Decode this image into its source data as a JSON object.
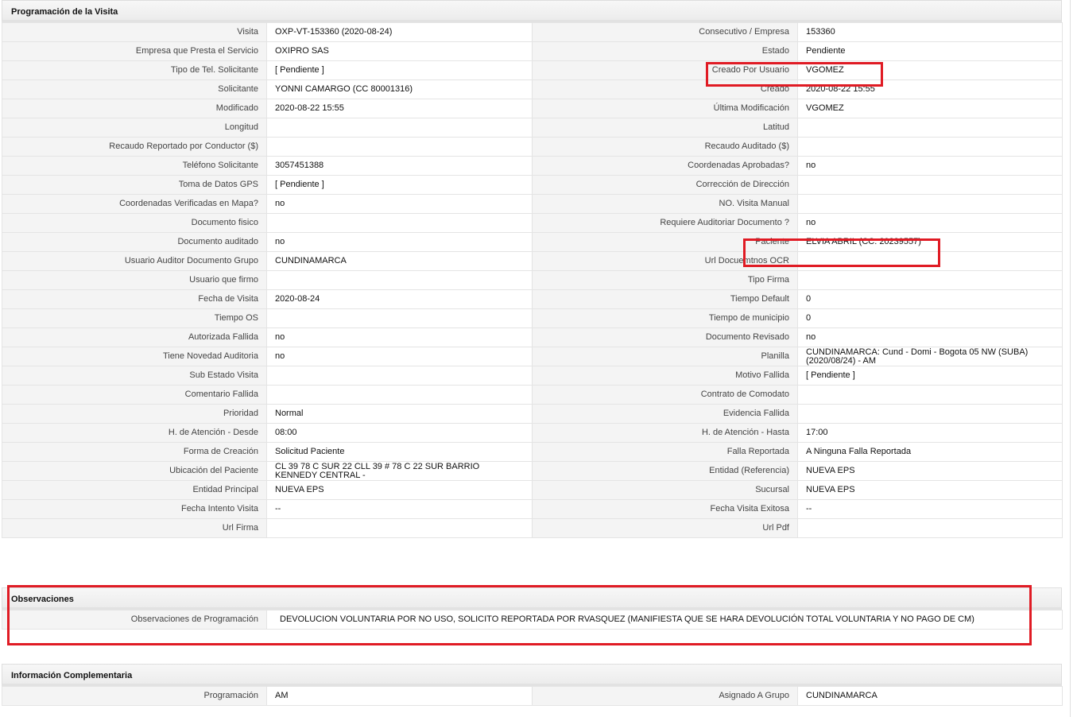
{
  "programacion": {
    "title": "Programación de la Visita",
    "rows": [
      [
        {
          "label": "Visita",
          "value": "OXP-VT-153360 (2020-08-24)"
        },
        {
          "label": "Consecutivo / Empresa",
          "value": "153360"
        }
      ],
      [
        {
          "label": "Empresa que Presta el Servicio",
          "value": "OXIPRO SAS"
        },
        {
          "label": "Estado",
          "value": "Pendiente"
        }
      ],
      [
        {
          "label": "Tipo de Tel. Solicitante",
          "value": "[ Pendiente ]"
        },
        {
          "label": "Creado Por Usuario",
          "value": "VGOMEZ"
        }
      ],
      [
        {
          "label": "Solicitante",
          "value": "YONNI CAMARGO (CC 80001316)"
        },
        {
          "label": "Creado",
          "value": "2020-08-22 15:55"
        }
      ],
      [
        {
          "label": "Modificado",
          "value": "2020-08-22 15:55"
        },
        {
          "label": "Última Modificación",
          "value": " VGOMEZ"
        }
      ],
      [
        {
          "label": "Longitud",
          "value": ""
        },
        {
          "label": "Latitud",
          "value": ""
        }
      ],
      [
        {
          "label": "Recaudo Reportado por Conductor ($)",
          "value": ""
        },
        {
          "label": "Recaudo Auditado ($)",
          "value": ""
        }
      ],
      [
        {
          "label": "Teléfono Solicitante",
          "value": "3057451388"
        },
        {
          "label": "Coordenadas Aprobadas?",
          "value": " no"
        }
      ],
      [
        {
          "label": "Toma de Datos GPS",
          "value": "[ Pendiente ]"
        },
        {
          "label": "Corrección de Dirección",
          "value": ""
        }
      ],
      [
        {
          "label": "Coordenadas Verificadas en Mapa?",
          "value": " no"
        },
        {
          "label": "NO. Visita Manual",
          "value": ""
        }
      ],
      [
        {
          "label": "Documento fisico",
          "value": ""
        },
        {
          "label": "Requiere Auditoriar Documento ?",
          "value": " no"
        }
      ],
      [
        {
          "label": "Documento auditado",
          "value": " no"
        },
        {
          "label": "Paciente",
          "value": "ELVIA ABRIL (CC: 20239557)"
        }
      ],
      [
        {
          "label": "Usuario Auditor Documento Grupo",
          "value": "CUNDINAMARCA"
        },
        {
          "label": "Url Docuemtnos OCR",
          "value": ""
        }
      ],
      [
        {
          "label": "Usuario que firmo",
          "value": ""
        },
        {
          "label": "Tipo Firma",
          "value": ""
        }
      ],
      [
        {
          "label": "Fecha de Visita",
          "value": " 2020-08-24"
        },
        {
          "label": "Tiempo Default",
          "value": "0"
        }
      ],
      [
        {
          "label": "Tiempo OS",
          "value": ""
        },
        {
          "label": "Tiempo de municipio",
          "value": "0"
        }
      ],
      [
        {
          "label": "Autorizada Fallida",
          "value": " no"
        },
        {
          "label": "Documento Revisado",
          "value": " no"
        }
      ],
      [
        {
          "label": "Tiene Novedad Auditoria",
          "value": " no"
        },
        {
          "label": "Planilla",
          "value": "CUNDINAMARCA: Cund - Domi - Bogota 05 NW (SUBA) (2020/08/24) - AM"
        }
      ],
      [
        {
          "label": "Sub Estado Visita",
          "value": ""
        },
        {
          "label": "Motivo Fallida",
          "value": "[ Pendiente ]"
        }
      ],
      [
        {
          "label": "Comentario Fallida",
          "value": ""
        },
        {
          "label": "Contrato de Comodato",
          "value": ""
        }
      ],
      [
        {
          "label": "Prioridad",
          "value": "Normal"
        },
        {
          "label": "Evidencia Fallida",
          "value": ""
        }
      ],
      [
        {
          "label": "H. de Atención - Desde",
          "value": "08:00"
        },
        {
          "label": "H. de Atención - Hasta",
          "value": "17:00"
        }
      ],
      [
        {
          "label": "Forma de Creación",
          "value": "Solicitud Paciente"
        },
        {
          "label": "Falla Reportada",
          "value": "A Ninguna Falla Reportada"
        }
      ],
      [
        {
          "label": "Ubicación del Paciente",
          "value": "CL 39 78 C SUR 22 CLL 39 # 78 C 22 SUR BARRIO KENNEDY CENTRAL -"
        },
        {
          "label": "Entidad (Referencia)",
          "value": "NUEVA EPS"
        }
      ],
      [
        {
          "label": "Entidad Principal",
          "value": "NUEVA EPS"
        },
        {
          "label": "Sucursal",
          "value": "NUEVA EPS"
        }
      ],
      [
        {
          "label": "Fecha Intento Visita",
          "value": " --"
        },
        {
          "label": "Fecha Visita Exitosa",
          "value": " --"
        }
      ],
      [
        {
          "label": "Url Firma",
          "value": ""
        },
        {
          "label": "Url Pdf",
          "value": ""
        }
      ]
    ]
  },
  "observaciones": {
    "title": "Observaciones",
    "label": "Observaciones de Programación",
    "value": "DEVOLUCION VOLUNTARIA POR NO USO, SOLICITO REPORTADA POR RVASQUEZ (MANIFIESTA QUE SE HARA DEVOLUCIÓN TOTAL VOLUNTARIA Y NO PAGO DE CM)"
  },
  "complementaria": {
    "title": "Información Complementaria",
    "rows": [
      [
        {
          "label": "Programación",
          "value": "AM"
        },
        {
          "label": "Asignado A Grupo",
          "value": "CUNDINAMARCA"
        }
      ]
    ]
  },
  "colors": {
    "highlight": "#e01b24",
    "label_bg": "#f4f4f4",
    "border": "#e4e4e4"
  }
}
